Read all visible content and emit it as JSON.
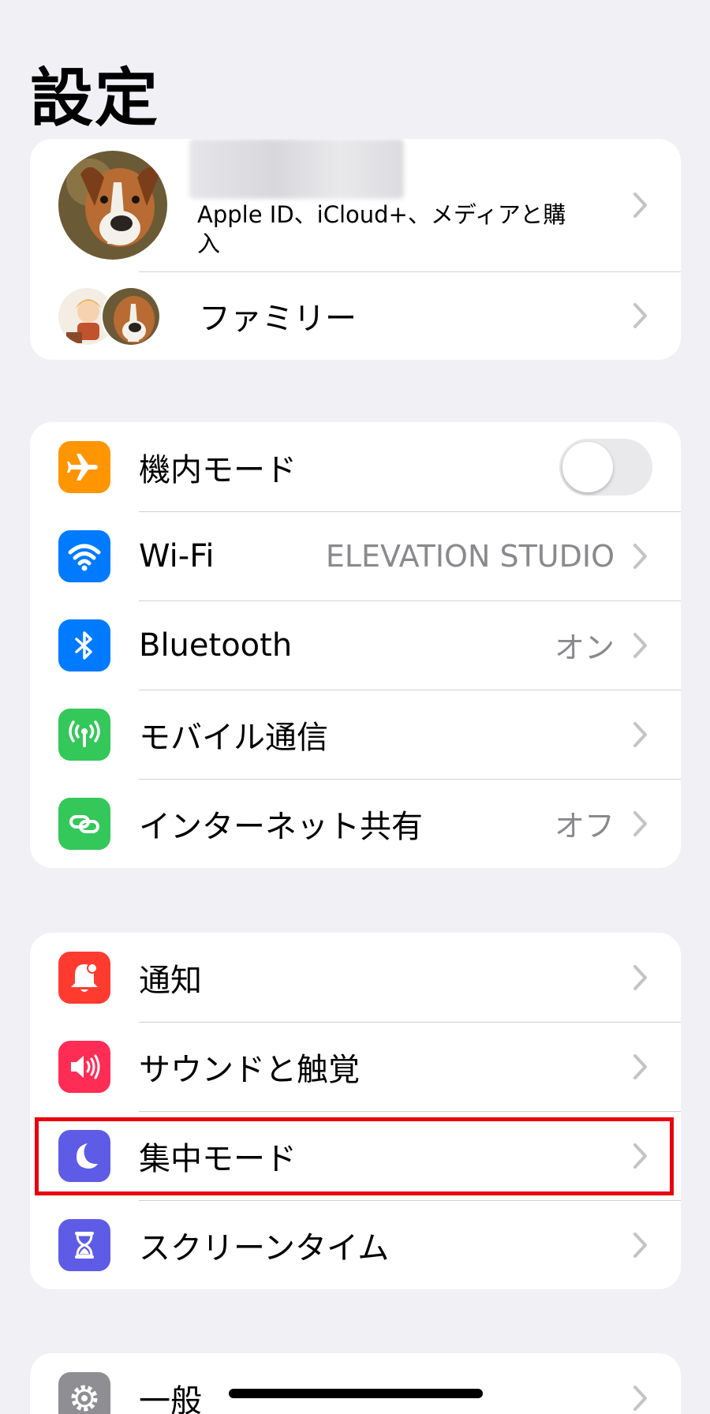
{
  "header": {
    "title": "設定"
  },
  "profile": {
    "subtitle": "Apple ID、iCloud+、メディアと購入",
    "family_label": "ファミリー"
  },
  "connectivity": [
    {
      "id": "airplane",
      "label": "機内モード",
      "icon": "airplane-icon",
      "color": "#ff9500",
      "toggle": false
    },
    {
      "id": "wifi",
      "label": "Wi-Fi",
      "value": "ELEVATION STUDIO",
      "icon": "wifi-icon",
      "color": "#007aff"
    },
    {
      "id": "bluetooth",
      "label": "Bluetooth",
      "value": "オン",
      "icon": "bluetooth-icon",
      "color": "#007aff"
    },
    {
      "id": "cellular",
      "label": "モバイル通信",
      "icon": "cellular-antenna-icon",
      "color": "#34c759"
    },
    {
      "id": "hotspot",
      "label": "インターネット共有",
      "value": "オフ",
      "icon": "hotspot-chain-icon",
      "color": "#34c759"
    }
  ],
  "notifications": [
    {
      "id": "notifications",
      "label": "通知",
      "icon": "bell-icon",
      "color": "#ff3b30"
    },
    {
      "id": "sounds",
      "label": "サウンドと触覚",
      "icon": "speaker-icon",
      "color": "#ff2d55"
    },
    {
      "id": "focus",
      "label": "集中モード",
      "icon": "moon-icon",
      "color": "#5e5ce6",
      "highlighted": true
    },
    {
      "id": "screentime",
      "label": "スクリーンタイム",
      "icon": "hourglass-icon",
      "color": "#5e5ce6"
    }
  ],
  "general": [
    {
      "id": "general",
      "label": "一般",
      "icon": "gear-icon",
      "color": "#8e8e93"
    }
  ],
  "accent": {
    "highlight_border": "#e8000f",
    "background": "#f0f0f5"
  }
}
